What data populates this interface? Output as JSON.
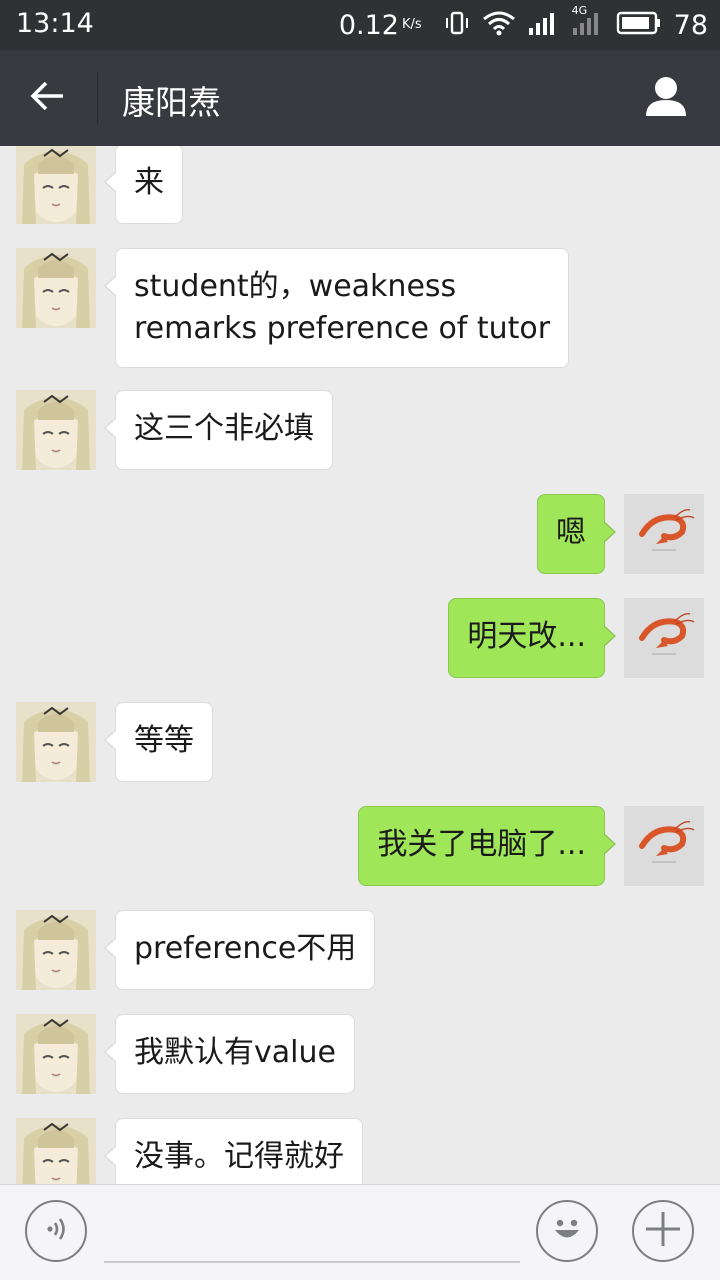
{
  "status_bar": {
    "time": "13:14",
    "net_speed": "0.12",
    "net_speed_unit": "K/s",
    "network_type": "4G",
    "battery": "78",
    "icons": [
      "vibrate-icon",
      "wifi-icon",
      "signal-icon",
      "signal-4g-icon",
      "battery-icon"
    ]
  },
  "header": {
    "title": "康阳焘",
    "back_icon": "back-arrow-icon",
    "profile_icon": "person-icon"
  },
  "messages": [
    {
      "side": "in",
      "text": "来"
    },
    {
      "side": "in",
      "text": "student的，weakness\nremarks preference of tutor"
    },
    {
      "side": "in",
      "text": "这三个非必填"
    },
    {
      "side": "out",
      "text": "嗯"
    },
    {
      "side": "out",
      "text": "明天改..."
    },
    {
      "side": "in",
      "text": "等等"
    },
    {
      "side": "out",
      "text": "我关了电脑了..."
    },
    {
      "side": "in",
      "text": "preference不用"
    },
    {
      "side": "in",
      "text": "我默认有value"
    },
    {
      "side": "in",
      "text": "没事。记得就好"
    }
  ],
  "input_bar": {
    "voice_icon": "voice-icon",
    "input_value": "",
    "emoji_icon": "emoji-icon",
    "more_icon": "plus-icon"
  },
  "colors": {
    "status_bar_bg": "#2f3133",
    "title_bar_bg": "#393a3f",
    "chat_bg": "#ebebeb",
    "incoming_bubble": "#ffffff",
    "outgoing_bubble": "#9fe659"
  }
}
